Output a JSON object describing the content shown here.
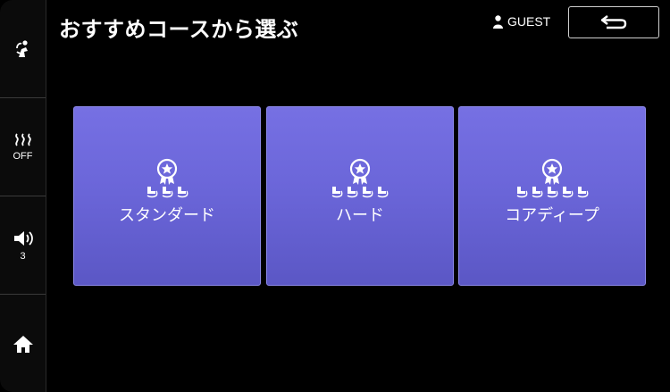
{
  "header": {
    "title": "おすすめコースから選ぶ",
    "user_label": "GUEST"
  },
  "sidebar": {
    "heat_status": "OFF",
    "volume_level": "3"
  },
  "courses": [
    {
      "label": "スタンダード",
      "intensity": 3
    },
    {
      "label": "ハード",
      "intensity": 4
    },
    {
      "label": "コアディープ",
      "intensity": 5
    }
  ],
  "colors": {
    "card": "#6b66d9",
    "background": "#000000"
  }
}
